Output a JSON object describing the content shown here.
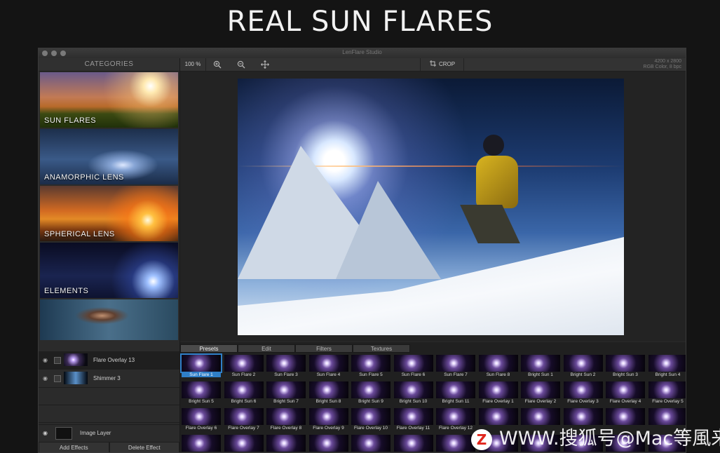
{
  "hero_title": "REAL SUN FLARES",
  "window": {
    "title": "LenFlare Studio",
    "info_line1": "4200 x 2800",
    "info_line2": "RGB Color, 8 bpc"
  },
  "toolbar": {
    "zoom": "100 %",
    "zoom_in_icon": "zoom-in-icon",
    "zoom_out_icon": "zoom-out-icon",
    "move_icon": "move-icon",
    "crop_label": "CROP"
  },
  "sidebar": {
    "header": "CATEGORIES",
    "categories": [
      {
        "label": "SUN FLARES"
      },
      {
        "label": "ANAMORPHIC LENS"
      },
      {
        "label": "SPHERICAL LENS"
      },
      {
        "label": "ELEMENTS"
      },
      {
        "label": ""
      }
    ],
    "layers": [
      {
        "name": "Flare Overlay 13"
      },
      {
        "name": "Shimmer 3"
      }
    ],
    "image_layer": "Image Layer",
    "add_effects": "Add Effects",
    "delete_effect": "Delete Effect"
  },
  "panel": {
    "tabs": [
      "Presets",
      "Edit",
      "Filters",
      "Textures"
    ],
    "active_tab": "Presets",
    "presets": [
      "Sun Flare 1",
      "Sun Flare 2",
      "Sun Flare 3",
      "Sun Flare 4",
      "Sun Flare 5",
      "Sun Flare 6",
      "Sun Flare 7",
      "Sun Flare 8",
      "Bright Sun 1",
      "Bright Sun 2",
      "Bright Sun 3",
      "Bright Sun 4",
      "Bright Sun 5",
      "Bright Sun 6",
      "Bright Sun 7",
      "Bright Sun 8",
      "Bright Sun 9",
      "Bright Sun 10",
      "Bright Sun 11",
      "Flare Overlay 1",
      "Flare Overlay 2",
      "Flare Overlay 3",
      "Flare Overlay 4",
      "Flare Overlay 5",
      "Flare Overlay 6",
      "Flare Overlay 7",
      "Flare Overlay 8",
      "Flare Overlay 9",
      "Flare Overlay 10",
      "Flare Overlay 11",
      "Flare Overlay 12",
      "",
      "",
      "",
      "",
      "",
      "",
      "",
      "",
      "",
      "",
      "",
      "",
      "",
      "",
      "",
      "",
      ""
    ],
    "selected_preset": "Sun Flare 1"
  },
  "watermark": "WWW.搜狐号@Mac等風来~",
  "colors": {
    "background": "#141414",
    "accent": "#2f7fc8"
  }
}
